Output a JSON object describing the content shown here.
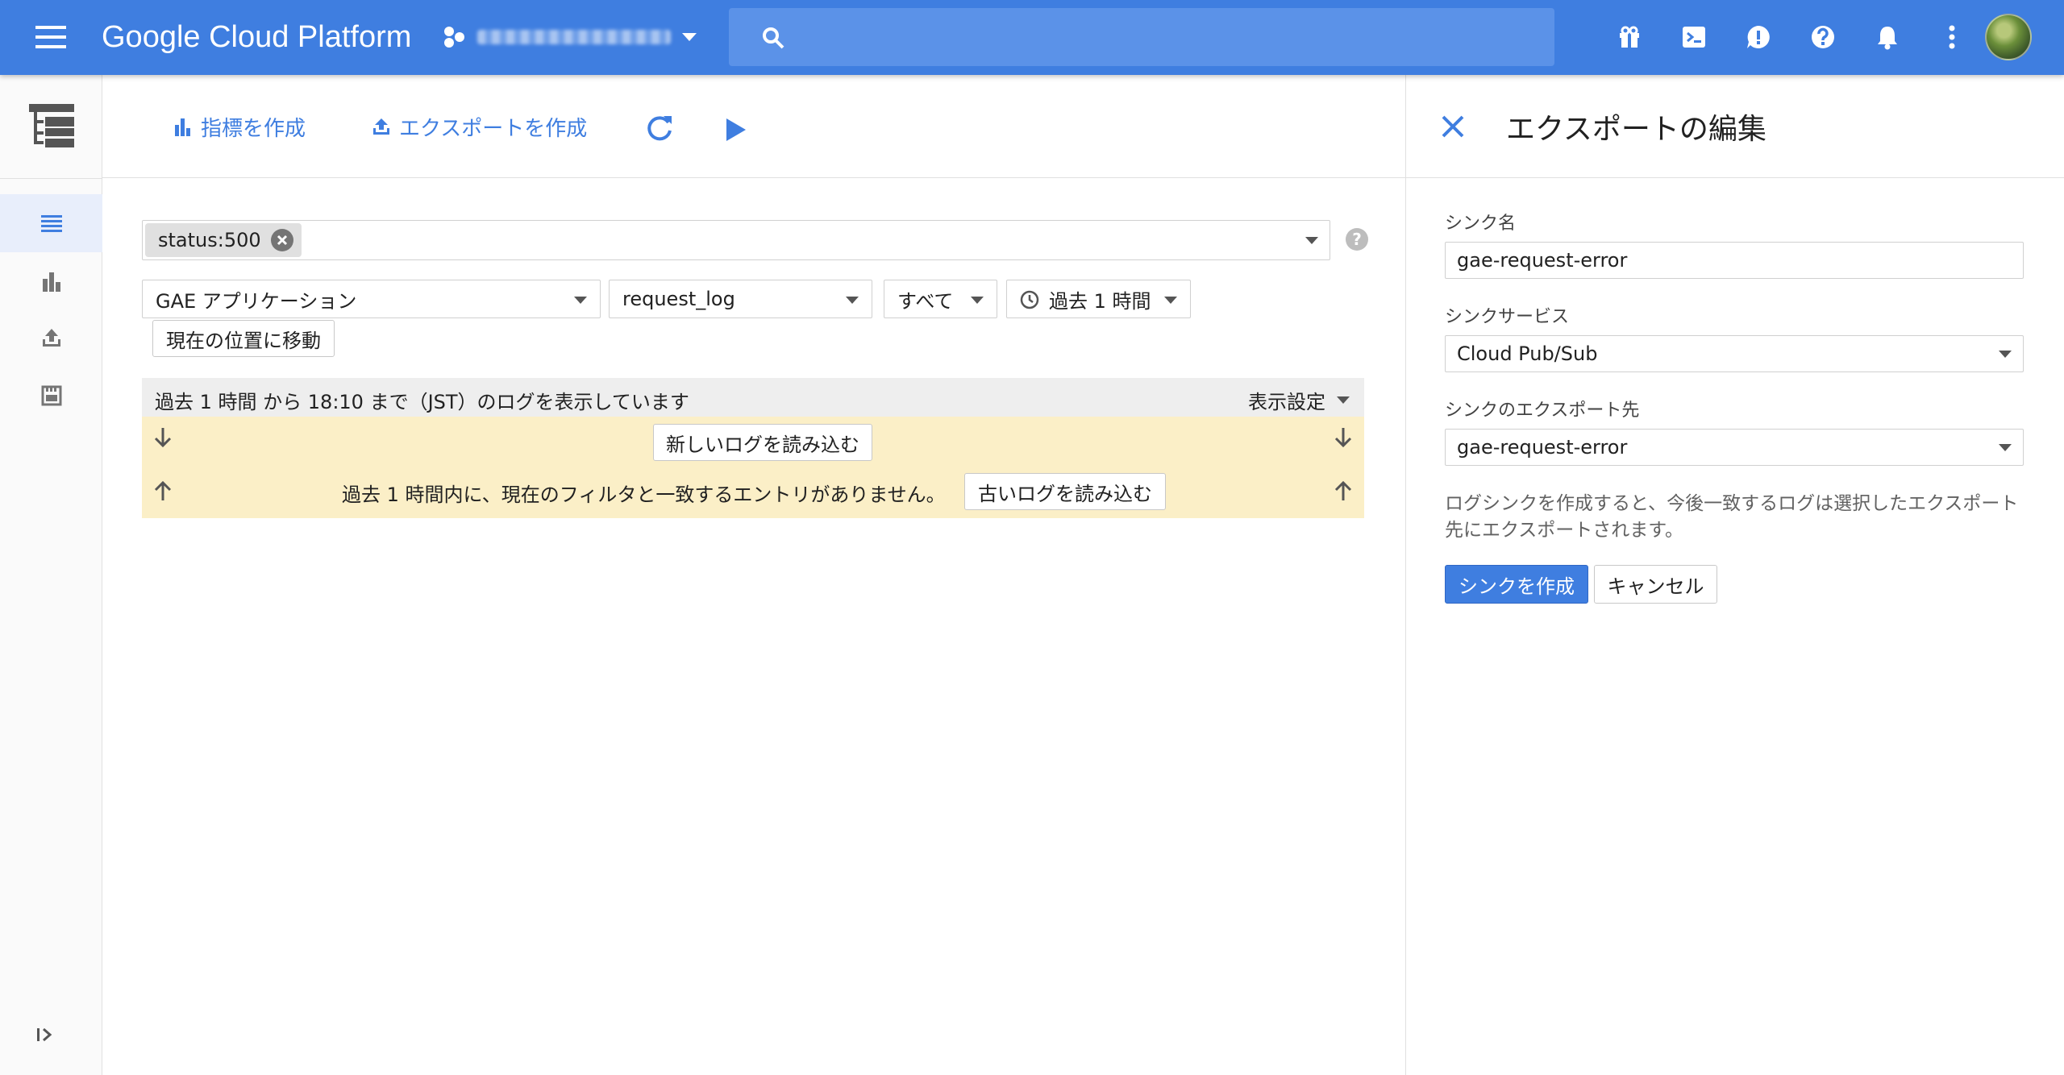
{
  "topbar": {
    "brand": "Google Cloud Platform",
    "search_placeholder": "",
    "colors": {
      "bar": "#3f7ee0",
      "search": "#5b92e8"
    }
  },
  "toolbar": {
    "create_metric": "指標を作成",
    "create_export": "エクスポートを作成"
  },
  "filters": {
    "chip": "status:500",
    "resource": "GAE アプリケーション",
    "log": "request_log",
    "level": "すべて",
    "time": "過去 1 時間",
    "jump_to_now": "現在の位置に移動"
  },
  "logs": {
    "range_text": "過去 1 時間 から 18:10 まで（JST）のログを表示しています",
    "view_settings": "表示設定",
    "load_newer": "新しいログを読み込む",
    "empty_message": "過去 1 時間内に、現在のフィルタと一致するエントリがありません。",
    "load_older": "古いログを読み込む",
    "colors": {
      "header": "#eeeeee",
      "body": "#fbefc7"
    }
  },
  "panel": {
    "title": "エクスポートの編集",
    "sink_name_label": "シンク名",
    "sink_name_value": "gae-request-error",
    "sink_service_label": "シンクサービス",
    "sink_service_value": "Cloud Pub/Sub",
    "sink_dest_label": "シンクのエクスポート先",
    "sink_dest_value": "gae-request-error",
    "help_text": "ログシンクを作成すると、今後一致するログは選択したエクスポート先にエクスポートされます。",
    "create_button": "シンクを作成",
    "cancel_button": "キャンセル",
    "colors": {
      "primary": "#3f7ee0"
    }
  },
  "icons": {
    "topbar": [
      "menu-icon",
      "project-icon",
      "search-icon",
      "gift-icon",
      "cloud-shell-icon",
      "feedback-icon",
      "help-icon",
      "notifications-icon",
      "more-vert-icon"
    ],
    "rail": [
      "logging-logo-icon",
      "logs-list-icon",
      "bar-chart-icon",
      "export-icon",
      "resource-icon",
      "expand-icon"
    ]
  }
}
